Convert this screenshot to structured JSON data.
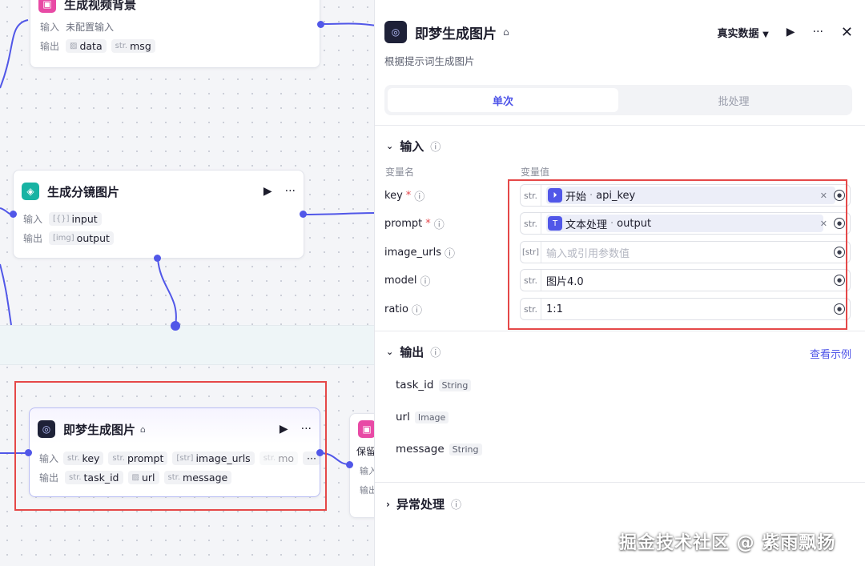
{
  "canvas": {
    "node_top": {
      "title": "生成视频背景",
      "input_label": "输入",
      "input_value": "未配置输入",
      "output_label": "输出",
      "outputs": [
        {
          "type": "img",
          "name": "data"
        },
        {
          "type": "str.",
          "name": "msg"
        }
      ]
    },
    "node_mid": {
      "title": "生成分镜图片",
      "input_label": "输入",
      "inputs": [
        {
          "type": "[{}]",
          "name": "input"
        }
      ],
      "output_label": "输出",
      "outputs": [
        {
          "type": "[img]",
          "name": "output"
        }
      ]
    },
    "node_selected": {
      "title": "即梦生成图片",
      "input_label": "输入",
      "inputs": [
        {
          "type": "str.",
          "name": "key"
        },
        {
          "type": "str.",
          "name": "prompt"
        },
        {
          "type": "[str]",
          "name": "image_urls"
        },
        {
          "type": "str.",
          "name": "mo"
        }
      ],
      "more_label": "···",
      "output_label": "输出",
      "outputs": [
        {
          "type": "str.",
          "name": "task_id"
        },
        {
          "type": "img",
          "name": "url"
        },
        {
          "type": "str.",
          "name": "message"
        }
      ]
    },
    "node_right_partial": {
      "title": "保留",
      "input_label": "输入",
      "output_label": "输出"
    }
  },
  "panel": {
    "title": "即梦生成图片",
    "subtitle": "根据提示词生成图片",
    "data_mode": "真实数据",
    "tabs": [
      "单次",
      "批处理"
    ],
    "active_tab": 0,
    "input_section": {
      "title": "输入",
      "col_name": "变量名",
      "col_value": "变量值",
      "params": [
        {
          "name": "key",
          "required": true,
          "type": "str.",
          "kind": "ref",
          "source": "开始",
          "field": "api_key",
          "source_icon": "start-node-icon"
        },
        {
          "name": "prompt",
          "required": true,
          "type": "str.",
          "kind": "ref",
          "source": "文本处理",
          "field": "output",
          "source_icon": "text-process-icon"
        },
        {
          "name": "image_urls",
          "required": false,
          "type": "[str]",
          "kind": "empty",
          "placeholder": "输入或引用参数值"
        },
        {
          "name": "model",
          "required": false,
          "type": "str.",
          "kind": "value",
          "value": "图片4.0"
        },
        {
          "name": "ratio",
          "required": false,
          "type": "str.",
          "kind": "value",
          "value": "1:1"
        }
      ]
    },
    "output_section": {
      "title": "输出",
      "example_link": "查看示例",
      "fields": [
        {
          "name": "task_id",
          "type": "String"
        },
        {
          "name": "url",
          "type": "Image"
        },
        {
          "name": "message",
          "type": "String"
        }
      ]
    },
    "error_section": {
      "title": "异常处理"
    }
  },
  "watermark": "掘金技术社区 @ 紫雨飘扬",
  "colors": {
    "accent": "#4d53e8",
    "highlight": "#e54848",
    "edge": "#5157e8"
  }
}
